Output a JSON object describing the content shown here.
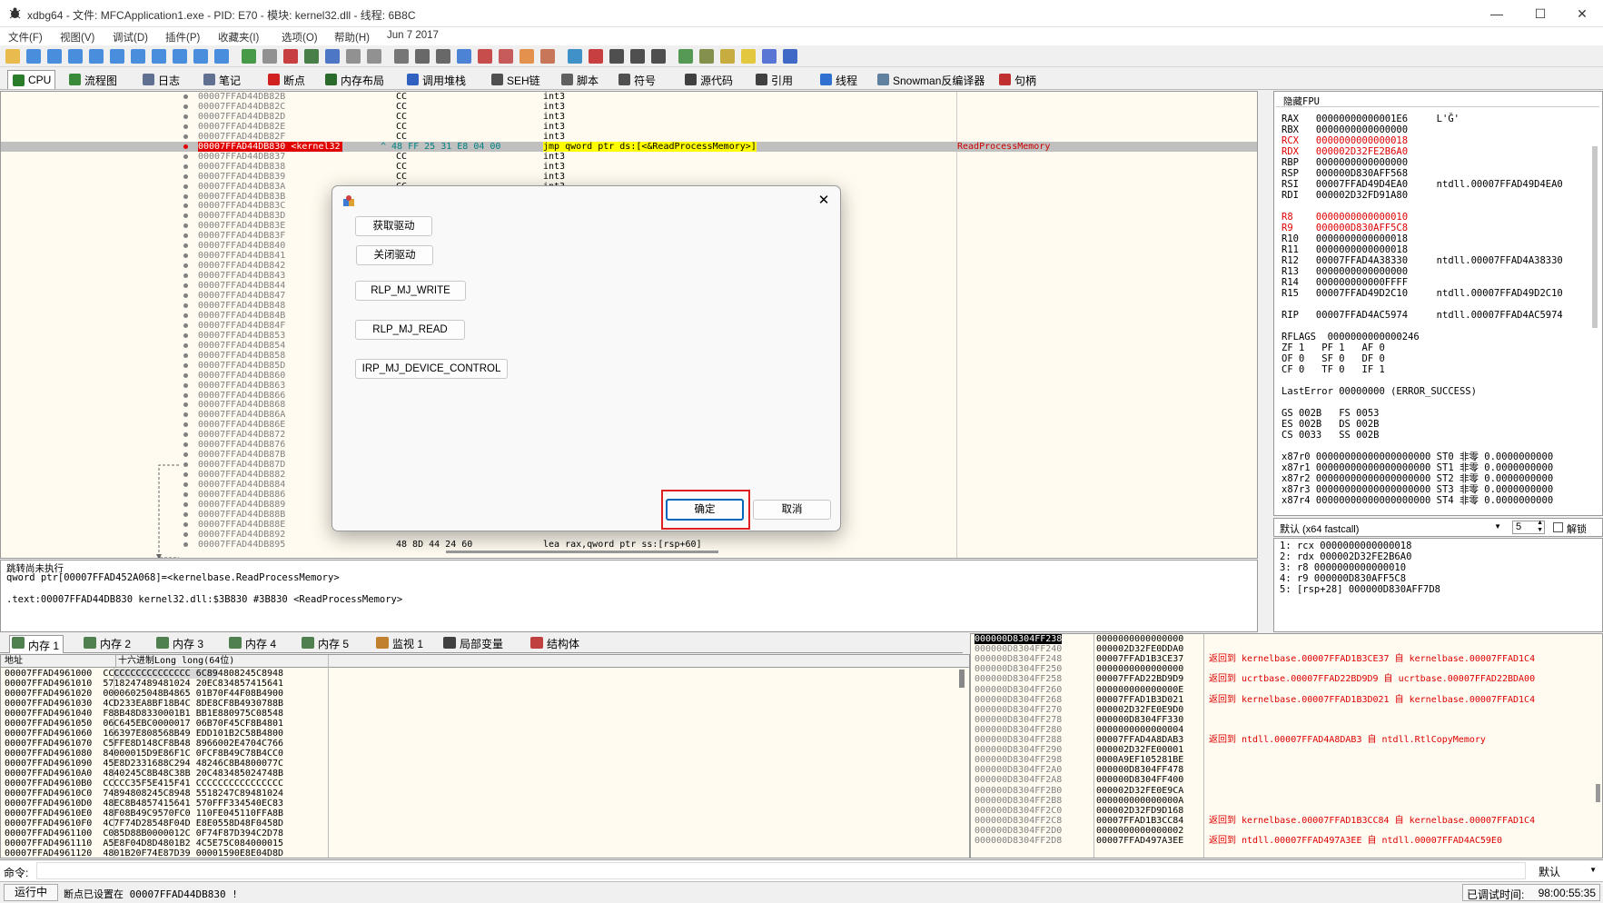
{
  "window": {
    "title": "xdbg64 - 文件: MFCApplication1.exe - PID: E70 - 模块: kernel32.dll - 线程: 6B8C"
  },
  "menu": [
    "文件(F)",
    "视图(V)",
    "调试(D)",
    "插件(P)",
    "收藏夹(I)",
    "选项(O)",
    "帮助(H)",
    "Jun 7 2017"
  ],
  "tabs": [
    {
      "label": "CPU",
      "color": "#2a7d2a"
    },
    {
      "label": "流程图",
      "color": "#3a8a3a"
    },
    {
      "label": "日志",
      "color": "#607090"
    },
    {
      "label": "笔记",
      "color": "#607090"
    },
    {
      "label": "断点",
      "color": "#d02020"
    },
    {
      "label": "内存布局",
      "color": "#2a6a2a"
    },
    {
      "label": "调用堆栈",
      "color": "#3060c0"
    },
    {
      "label": "SEH链",
      "color": "#505050"
    },
    {
      "label": "脚本",
      "color": "#606060"
    },
    {
      "label": "符号",
      "color": "#505050"
    },
    {
      "label": "源代码",
      "color": "#404040"
    },
    {
      "label": "引用",
      "color": "#404040"
    },
    {
      "label": "线程",
      "color": "#3070d0"
    },
    {
      "label": "Snowman反编译器",
      "color": "#6080a0"
    },
    {
      "label": "句柄",
      "color": "#c03030"
    }
  ],
  "disasm": [
    {
      "addr": "00007FFAD44DB82B",
      "bytes": "CC",
      "instr": "int3"
    },
    {
      "addr": "00007FFAD44DB82C",
      "bytes": "CC",
      "instr": "int3"
    },
    {
      "addr": "00007FFAD44DB82D",
      "bytes": "CC",
      "instr": "int3"
    },
    {
      "addr": "00007FFAD44DB82E",
      "bytes": "CC",
      "instr": "int3"
    },
    {
      "addr": "00007FFAD44DB82F",
      "bytes": "CC",
      "instr": "int3"
    },
    {
      "addr": "00007FFAD44DB830 <kernel32",
      "bytes": "^ 48 FF 25 31 E8 04 00",
      "instr": "jmp qword ptr ds:[<&ReadProcessMemory>]",
      "cmt": "ReadProcessMemory",
      "selected": true
    },
    {
      "addr": "00007FFAD44DB837",
      "bytes": "CC",
      "instr": "int3"
    },
    {
      "addr": "00007FFAD44DB838",
      "bytes": "CC",
      "instr": "int3"
    },
    {
      "addr": "00007FFAD44DB839",
      "bytes": "CC",
      "instr": "int3"
    },
    {
      "addr": "00007FFAD44DB83A",
      "bytes": "CC",
      "instr": "int3"
    },
    {
      "addr": "00007FFAD44DB83B",
      "bytes": "",
      "instr": ""
    },
    {
      "addr": "00007FFAD44DB83C",
      "bytes": "",
      "instr": ""
    },
    {
      "addr": "00007FFAD44DB83D",
      "bytes": "",
      "instr": ""
    },
    {
      "addr": "00007FFAD44DB83E",
      "bytes": "",
      "instr": ""
    },
    {
      "addr": "00007FFAD44DB83F",
      "bytes": "",
      "instr": ""
    },
    {
      "addr": "00007FFAD44DB840",
      "bytes": "",
      "instr": ""
    },
    {
      "addr": "00007FFAD44DB841",
      "bytes": "",
      "instr": ""
    },
    {
      "addr": "00007FFAD44DB842",
      "bytes": "",
      "instr": ""
    },
    {
      "addr": "00007FFAD44DB843",
      "bytes": "",
      "instr": ""
    },
    {
      "addr": "00007FFAD44DB844",
      "bytes": "",
      "instr": ""
    },
    {
      "addr": "00007FFAD44DB847",
      "bytes": "",
      "instr": ""
    },
    {
      "addr": "00007FFAD44DB848",
      "bytes": "",
      "instr": ""
    },
    {
      "addr": "00007FFAD44DB84B",
      "bytes": "",
      "instr": ""
    },
    {
      "addr": "00007FFAD44DB84F",
      "bytes": "",
      "instr": ""
    },
    {
      "addr": "00007FFAD44DB853",
      "bytes": "",
      "instr": ""
    },
    {
      "addr": "00007FFAD44DB854",
      "bytes": "",
      "instr": ""
    },
    {
      "addr": "00007FFAD44DB858",
      "bytes": "",
      "instr": ""
    },
    {
      "addr": "00007FFAD44DB85D",
      "bytes": "",
      "instr": ""
    },
    {
      "addr": "00007FFAD44DB860",
      "bytes": "",
      "instr": ""
    },
    {
      "addr": "00007FFAD44DB863",
      "bytes": "",
      "instr": ""
    },
    {
      "addr": "00007FFAD44DB866",
      "bytes": "",
      "instr": ""
    },
    {
      "addr": "00007FFAD44DB868",
      "bytes": "",
      "instr": ""
    },
    {
      "addr": "00007FFAD44DB86A",
      "bytes": "",
      "instr": ""
    },
    {
      "addr": "00007FFAD44DB86E",
      "bytes": "",
      "instr": ""
    },
    {
      "addr": "00007FFAD44DB872",
      "bytes": "",
      "instr": ""
    },
    {
      "addr": "00007FFAD44DB876",
      "bytes": "",
      "instr": ""
    },
    {
      "addr": "00007FFAD44DB87B",
      "bytes": "",
      "instr": ""
    },
    {
      "addr": "00007FFAD44DB87D",
      "bytes": "",
      "instr": ""
    },
    {
      "addr": "00007FFAD44DB882",
      "bytes": "",
      "instr": ""
    },
    {
      "addr": "00007FFAD44DB884",
      "bytes": "",
      "instr": ""
    },
    {
      "addr": "00007FFAD44DB886",
      "bytes": "",
      "instr": ""
    },
    {
      "addr": "00007FFAD44DB889",
      "bytes": "",
      "instr": ""
    },
    {
      "addr": "00007FFAD44DB88B",
      "bytes": "",
      "instr": ""
    },
    {
      "addr": "00007FFAD44DB88E",
      "bytes": "",
      "instr": ""
    },
    {
      "addr": "00007FFAD44DB892",
      "bytes": "",
      "instr": ""
    },
    {
      "addr": "00007FFAD44DB895",
      "bytes": "48 8D 44 24 60",
      "instr": "lea rax,qword ptr ss:[rsp+60]"
    }
  ],
  "info": {
    "line1": "跳转尚未执行",
    "line2": "qword ptr[00007FFAD452A068]=<kernelbase.ReadProcessMemory>",
    "line3": ".text:00007FFAD44DB830 kernel32.dll:$3B830 #3B830 <ReadProcessMemory>"
  },
  "registers": {
    "header": "隐藏FPU",
    "lines": [
      {
        "t": "RAX   00000000000001E6     L'Ǧ'",
        "c": "#000"
      },
      {
        "t": "RBX   0000000000000000",
        "c": "#000"
      },
      {
        "t": "RCX   0000000000000018",
        "c": "#d00"
      },
      {
        "t": "RDX   000002D32FE2B6A0",
        "c": "#d00"
      },
      {
        "t": "RBP   0000000000000000",
        "c": "#000"
      },
      {
        "t": "RSP   000000D830AFF568",
        "c": "#000"
      },
      {
        "t": "RSI   00007FFAD49D4EA0     ntdll.00007FFAD49D4EA0",
        "c": "#000"
      },
      {
        "t": "RDI   000002D32FD91A80",
        "c": "#000"
      },
      {
        "t": "",
        "c": "#000"
      },
      {
        "t": "R8    0000000000000010",
        "c": "#d00"
      },
      {
        "t": "R9    000000D830AFF5C8",
        "c": "#d00"
      },
      {
        "t": "R10   0000000000000018",
        "c": "#000"
      },
      {
        "t": "R11   0000000000000018",
        "c": "#000"
      },
      {
        "t": "R12   00007FFAD4A38330     ntdll.00007FFAD4A38330",
        "c": "#000"
      },
      {
        "t": "R13   0000000000000000",
        "c": "#000"
      },
      {
        "t": "R14   000000000000FFFF",
        "c": "#000"
      },
      {
        "t": "R15   00007FFAD49D2C10     ntdll.00007FFAD49D2C10",
        "c": "#000"
      },
      {
        "t": "",
        "c": "#000"
      },
      {
        "t": "RIP   00007FFAD4AC5974     ntdll.00007FFAD4AC5974",
        "c": "#000"
      },
      {
        "t": "",
        "c": "#000"
      },
      {
        "t": "RFLAGS  0000000000000246",
        "c": "#000"
      },
      {
        "t": "ZF 1   PF 1   AF 0",
        "c": "#000"
      },
      {
        "t": "OF 0   SF 0   DF 0",
        "c": "#000"
      },
      {
        "t": "CF 0   TF 0   IF 1",
        "c": "#000"
      },
      {
        "t": "",
        "c": "#000"
      },
      {
        "t": "LastError 00000000 (ERROR_SUCCESS)",
        "c": "#000"
      },
      {
        "t": "",
        "c": "#000"
      },
      {
        "t": "GS 002B   FS 0053",
        "c": "#000"
      },
      {
        "t": "ES 002B   DS 002B",
        "c": "#000"
      },
      {
        "t": "CS 0033   SS 002B",
        "c": "#000"
      },
      {
        "t": "",
        "c": "#000"
      },
      {
        "t": "x87r0 00000000000000000000 ST0 非零 0.0000000000",
        "c": "#000"
      },
      {
        "t": "x87r1 00000000000000000000 ST1 非零 0.0000000000",
        "c": "#000"
      },
      {
        "t": "x87r2 00000000000000000000 ST2 非零 0.0000000000",
        "c": "#000"
      },
      {
        "t": "x87r3 00000000000000000000 ST3 非零 0.0000000000",
        "c": "#000"
      },
      {
        "t": "x87r4 00000000000000000000 ST4 非零 0.0000000000",
        "c": "#000"
      }
    ]
  },
  "callconv": {
    "label": "默认 (x64 fastcall)",
    "argc": "5",
    "unlock": "解锁"
  },
  "args": "1: rcx 0000000000000018\n2: rdx 000002D32FE2B6A0\n3: r8 0000000000000010\n4: r9 000000D830AFF5C8\n5: [rsp+28] 000000D830AFF7D8",
  "memtabs": [
    {
      "label": "内存 1",
      "color": "#508050"
    },
    {
      "label": "内存 2",
      "color": "#508050"
    },
    {
      "label": "内存 3",
      "color": "#508050"
    },
    {
      "label": "内存 4",
      "color": "#508050"
    },
    {
      "label": "内存 5",
      "color": "#508050"
    },
    {
      "label": "监视 1",
      "color": "#c08030"
    },
    {
      "label": "局部变量",
      "color": "#404040"
    },
    {
      "label": "结构体",
      "color": "#c04040"
    }
  ],
  "dump": {
    "col_addr": "地址",
    "col_hex": "十六进制Long long(64位)",
    "rows": [
      "00007FFAD4961000  CCCCCCCCCCCCCCCC 6C894808245C8948",
      "00007FFAD4961010  5718247489481024 20EC834857415641",
      "00007FFAD4961020  00006025048B4865 01B70F44F08B4900",
      "00007FFAD4961030  4CD233EA8BF18B4C 8DE8CF8B4930788B",
      "00007FFAD4961040  F88B48D8330001B1 BB1E880975C08548",
      "00007FFAD4961050  06C645EBC0000017 06B70F45CF8B4801",
      "00007FFAD4961060  166397E808568B49 EDD101B2C58B4800",
      "00007FFAD4961070  C5FFE8D148CF8B48 8966002E4704C766",
      "00007FFAD4961080  84000015D9E86F1C 0FCF8B49C78B4CC0",
      "00007FFAD4961090  45E8D2331688C294 48246C8B4800077C",
      "00007FFAD49610A0  4840245C8B48C38B 20C483485024748B",
      "00007FFAD49610B0  CCCCC35F5E415F41 CCCCCCCCCCCCCCCC",
      "00007FFAD49610C0  74894808245C8948 5518247C89481024",
      "00007FFAD49610D0  48EC8B4857415641 570FFF334540EC83",
      "00007FFAD49610E0  48F08B49C9570FC0 110FE045110FFA8B",
      "00007FFAD49610F0  4C7F74D28548F04D E8E0558D48F0458D",
      "00007FFAD4961100  C085D88B0000012C 0F74F87D394C2D78",
      "00007FFAD4961110  A5E8F04D8D4801B2 4C5E75C084000015",
      "00007FFAD4961120  4801B20F74E87D39 00001590E8E04D8D"
    ]
  },
  "stack": {
    "rows": [
      {
        "a": "000000D8304FF238",
        "v": "0000000000000000",
        "c": "",
        "sel": true
      },
      {
        "a": "000000D8304FF240",
        "v": "000002D32FE0DDA0",
        "c": ""
      },
      {
        "a": "000000D8304FF248",
        "v": "00007FFAD1B3CE37",
        "c": "返回到 kernelbase.00007FFAD1B3CE37 自 kernelbase.00007FFAD1C4"
      },
      {
        "a": "000000D8304FF250",
        "v": "0000000000000000",
        "c": ""
      },
      {
        "a": "000000D8304FF258",
        "v": "00007FFAD22BD9D9",
        "c": "返回到 ucrtbase.00007FFAD22BD9D9 自 ucrtbase.00007FFAD22BDA00"
      },
      {
        "a": "000000D8304FF260",
        "v": "000000000000000E",
        "c": ""
      },
      {
        "a": "000000D8304FF268",
        "v": "00007FFAD1B3D021",
        "c": "返回到 kernelbase.00007FFAD1B3D021 自 kernelbase.00007FFAD1C4"
      },
      {
        "a": "000000D8304FF270",
        "v": "000002D32FE0E9D0",
        "c": ""
      },
      {
        "a": "000000D8304FF278",
        "v": "000000D8304FF330",
        "c": ""
      },
      {
        "a": "000000D8304FF280",
        "v": "0000000000000004",
        "c": ""
      },
      {
        "a": "000000D8304FF288",
        "v": "00007FFAD4A8DAB3",
        "c": "返回到 ntdll.00007FFAD4A8DAB3 自 ntdll.RtlCopyMemory"
      },
      {
        "a": "000000D8304FF290",
        "v": "000002D32FE00001",
        "c": ""
      },
      {
        "a": "000000D8304FF298",
        "v": "0000A9EF105281BE",
        "c": ""
      },
      {
        "a": "000000D8304FF2A0",
        "v": "000000D8304FF478",
        "c": ""
      },
      {
        "a": "000000D8304FF2A8",
        "v": "000000D8304FF400",
        "c": ""
      },
      {
        "a": "000000D8304FF2B0",
        "v": "000002D32FE0E9CA",
        "c": ""
      },
      {
        "a": "000000D8304FF2B8",
        "v": "000000000000000A",
        "c": ""
      },
      {
        "a": "000000D8304FF2C0",
        "v": "000002D32FD9D168",
        "c": ""
      },
      {
        "a": "000000D8304FF2C8",
        "v": "00007FFAD1B3CC84",
        "c": "返回到 kernelbase.00007FFAD1B3CC84 自 kernelbase.00007FFAD1C4"
      },
      {
        "a": "000000D8304FF2D0",
        "v": "0000000000000002",
        "c": ""
      },
      {
        "a": "000000D8304FF2D8",
        "v": "00007FFAD497A3EE",
        "c": "返回到 ntdll.00007FFAD497A3EE 自 ntdll.00007FFAD4AC59E0"
      }
    ]
  },
  "cmd": {
    "label": "命令:",
    "mode": "默认"
  },
  "status": {
    "state": "运行中",
    "message": "断点已设置在 00007FFAD44DB830 !",
    "debug_time_label": "已调试时间:",
    "debug_time": "98:00:55:35"
  },
  "dialog": {
    "buttons": [
      "获取驱动",
      "关闭驱动",
      "RLP_MJ_WRITE",
      "RLP_MJ_READ",
      "IRP_MJ_DEVICE_CONTROL"
    ],
    "ok": "确定",
    "cancel": "取消"
  }
}
